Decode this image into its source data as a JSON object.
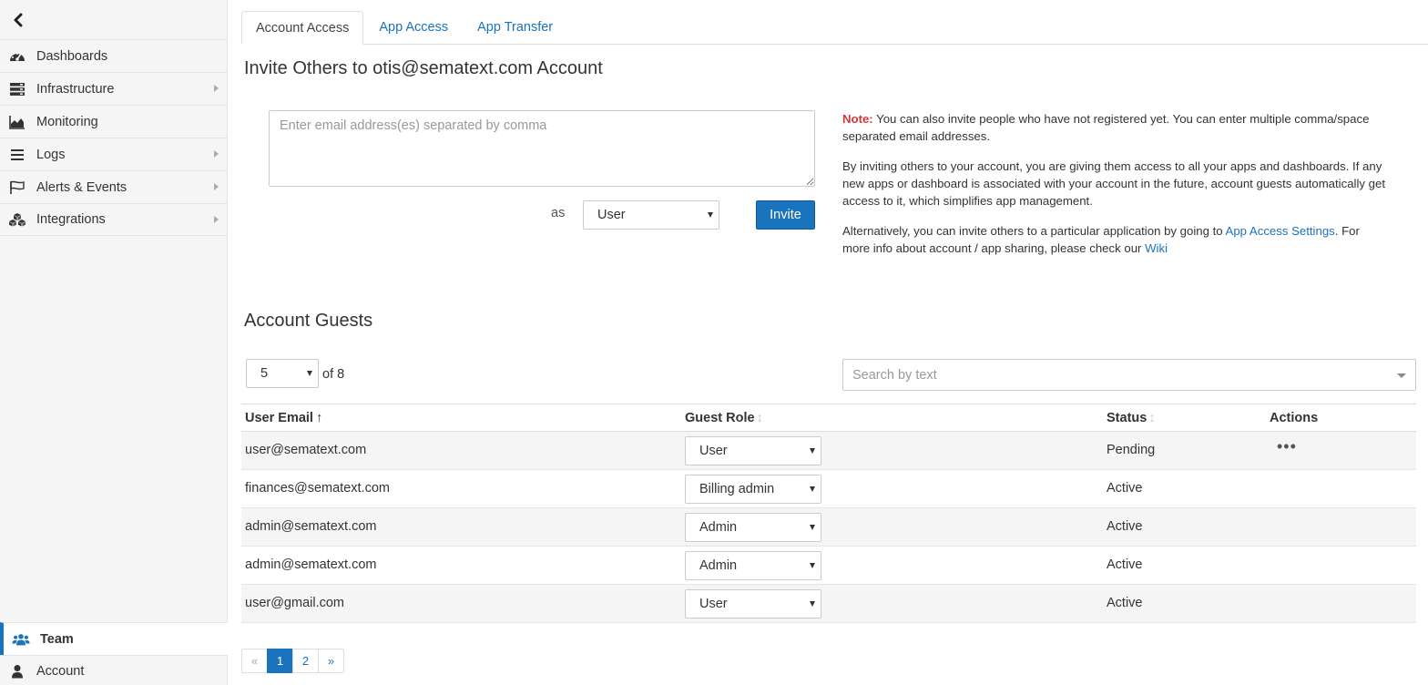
{
  "sidebar": {
    "items": [
      {
        "label": "Dashboards",
        "icon": "dashboard-gauge-icon",
        "has_arrow": false
      },
      {
        "label": "Infrastructure",
        "icon": "server-stack-icon",
        "has_arrow": true
      },
      {
        "label": "Monitoring",
        "icon": "area-chart-icon",
        "has_arrow": false
      },
      {
        "label": "Logs",
        "icon": "list-lines-icon",
        "has_arrow": true
      },
      {
        "label": "Alerts & Events",
        "icon": "flag-icon",
        "has_arrow": true
      },
      {
        "label": "Integrations",
        "icon": "cubes-icon",
        "has_arrow": true
      }
    ],
    "bottom": {
      "team_label": "Team",
      "account_label": "Account"
    }
  },
  "tabs": [
    {
      "label": "Account Access",
      "active": true
    },
    {
      "label": "App Access",
      "active": false
    },
    {
      "label": "App Transfer",
      "active": false
    }
  ],
  "invite": {
    "heading": "Invite Others to otis@sematext.com Account",
    "email_placeholder": "Enter email address(es) separated by comma",
    "as_label": "as",
    "role_value": "User",
    "button_label": "Invite"
  },
  "note": {
    "label": "Note:",
    "p1": " You can also invite people who have not registered yet. You can enter multiple comma/space separated email addresses.",
    "p2": "By inviting others to your account, you are giving them access to all your apps and dashboards. If any new apps or dashboard is associated with your account in the future, account guests automatically get access to it, which simplifies app management.",
    "p3_before": "Alternatively, you can invite others to a particular application by going to ",
    "p3_link": "App Access Settings",
    "p3_middle": ". For more info about account / app sharing, please check our ",
    "p3_wiki": "Wiki"
  },
  "guests": {
    "heading": "Account Guests",
    "page_size": "5",
    "of_total": "of 8",
    "search_placeholder": "Search by text",
    "columns": {
      "email": "User Email",
      "role": "Guest Role",
      "status": "Status",
      "actions": "Actions"
    },
    "rows": [
      {
        "email": "user@sematext.com",
        "role": "User",
        "status": "Pending",
        "actions": "•••"
      },
      {
        "email": "finances@sematext.com",
        "role": "Billing admin",
        "status": "Active",
        "actions": ""
      },
      {
        "email": "admin@sematext.com",
        "role": "Admin",
        "status": "Active",
        "actions": ""
      },
      {
        "email": "admin@sematext.com",
        "role": "Admin",
        "status": "Active",
        "actions": ""
      },
      {
        "email": "user@gmail.com",
        "role": "User",
        "status": "Active",
        "actions": ""
      }
    ],
    "pagination": {
      "prev": "«",
      "pages": [
        "1",
        "2"
      ],
      "current": "1",
      "next": "»"
    }
  },
  "colors": {
    "accent": "#1a73bd",
    "note_red": "#d0393b",
    "sidebar_bg": "#f5f5f5"
  }
}
